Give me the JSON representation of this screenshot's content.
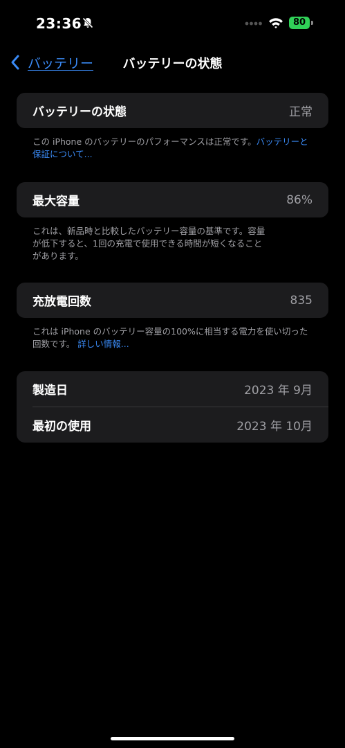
{
  "status_bar": {
    "time": "23:36",
    "battery_level": "80"
  },
  "nav": {
    "back_label": "バッテリー",
    "title": "バッテリーの状態"
  },
  "health": {
    "label": "バッテリーの状態",
    "value": "正常",
    "note": "この iPhone のバッテリーのパフォーマンスは正常です。",
    "link": "バッテリーと保証について..."
  },
  "capacity": {
    "label": "最大容量",
    "value": "86%",
    "note_line1": "これは、新品時と比較したバッテリー容量の基準です。容量",
    "note_line2": "が低下すると、1回の充電で使用できる時間が短くなること",
    "note_line3": "があります。"
  },
  "cycles": {
    "label": "充放電回数",
    "value": "835",
    "note": "これは iPhone のバッテリー容量の100%に相当する電力を使い切った回数です。",
    "link": "詳しい情報..."
  },
  "dates": {
    "manufactured_label": "製造日",
    "manufactured_value": "2023 年 9月",
    "first_use_label": "最初の使用",
    "first_use_value": "2023 年 10月"
  },
  "colors": {
    "accent": "#3a8af5",
    "card": "#1c1c1e",
    "battery": "#30d158"
  }
}
